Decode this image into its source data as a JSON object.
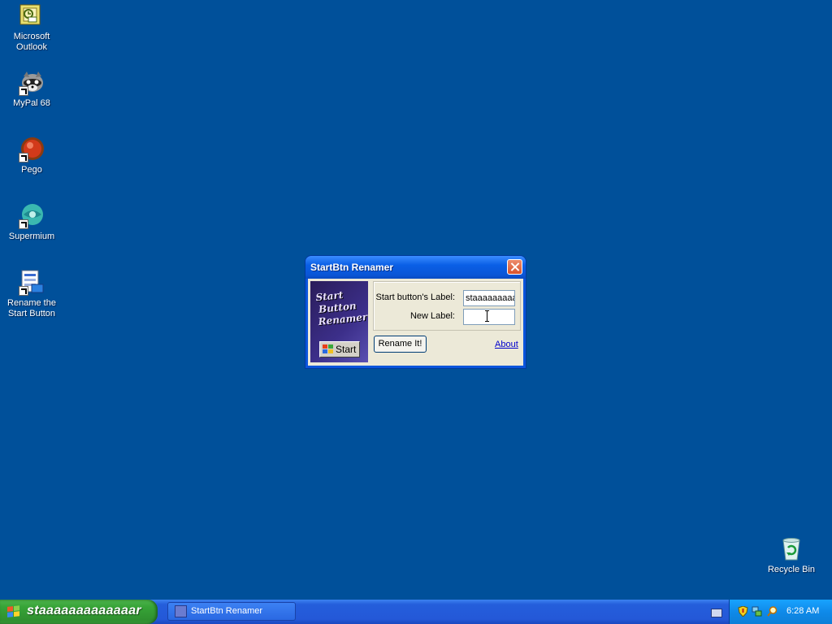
{
  "desktop": {
    "icons": [
      {
        "label_line1": "Microsoft",
        "label_line2": "Outlook",
        "icon": "outlook-icon"
      },
      {
        "label_line1": "MyPal 68",
        "label_line2": "",
        "icon": "raccoon-icon"
      },
      {
        "label_line1": "Pego",
        "label_line2": "",
        "icon": "pego-icon"
      },
      {
        "label_line1": "Supermium",
        "label_line2": "",
        "icon": "supermium-icon"
      },
      {
        "label_line1": "Rename the",
        "label_line2": "Start Button",
        "icon": "rename-start-icon"
      },
      {
        "label_line1": "Recycle Bin",
        "label_line2": "",
        "icon": "recycle-bin-icon"
      }
    ]
  },
  "dialog": {
    "title": "StartBtn Renamer",
    "logo_text": [
      "Start",
      "Button",
      "Renamer"
    ],
    "preview_button_label": "Start",
    "current_label_caption": "Start button's Label:",
    "current_label_value": "staaaaaaaaaaaaaaa",
    "new_label_caption": "New Label:",
    "new_label_value": "",
    "rename_button": "Rename It!",
    "about_link": "About"
  },
  "taskbar": {
    "start_label": "staaaaaaaaaaaaar",
    "task_button_label": "StartBtn Renamer",
    "clock": "6:28 AM",
    "tray_icons": [
      "security-shield-icon",
      "network-icon",
      "search-icon"
    ]
  },
  "colors": {
    "desktop_bg": "#00509a",
    "taskbar_blue": "#245edb",
    "start_green": "#37a437",
    "title_blue": "#0a55d6"
  }
}
